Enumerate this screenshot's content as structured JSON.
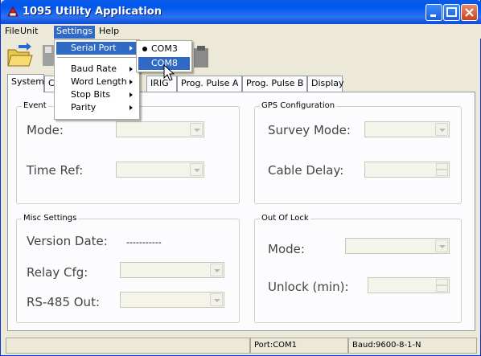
{
  "window": {
    "title": "1095 Utility Application"
  },
  "menubar": [
    "File",
    "Unit",
    "Settings",
    "Help"
  ],
  "settings_menu": {
    "items": [
      "Serial Port",
      "Baud Rate",
      "Word Length",
      "Stop Bits",
      "Parity"
    ],
    "serial_submenu": {
      "items": [
        "COM3",
        "COM8"
      ],
      "checked": "COM3",
      "hover": "COM8"
    }
  },
  "tabs": [
    "System",
    "C",
    "IRIG",
    "Prog. Pulse A",
    "Prog. Pulse B",
    "Display"
  ],
  "event_group": {
    "label": "Event",
    "mode_label": "Mode:",
    "timeref_label": "Time Ref:"
  },
  "gps_group": {
    "label": "GPS Configuration",
    "survey_label": "Survey Mode:",
    "cable_label": "Cable Delay:"
  },
  "misc_group": {
    "label": "Misc Settings",
    "version_label": "Version Date:",
    "version_value": "-----------",
    "relay_label": "Relay Cfg:",
    "rs485_label": "RS-485 Out:"
  },
  "outoflock_group": {
    "label": "Out Of Lock",
    "mode_label": "Mode:",
    "unlock_label": "Unlock (min):"
  },
  "status": {
    "port": "Port:COM1",
    "baud": "Baud:9600-8-1-N"
  }
}
